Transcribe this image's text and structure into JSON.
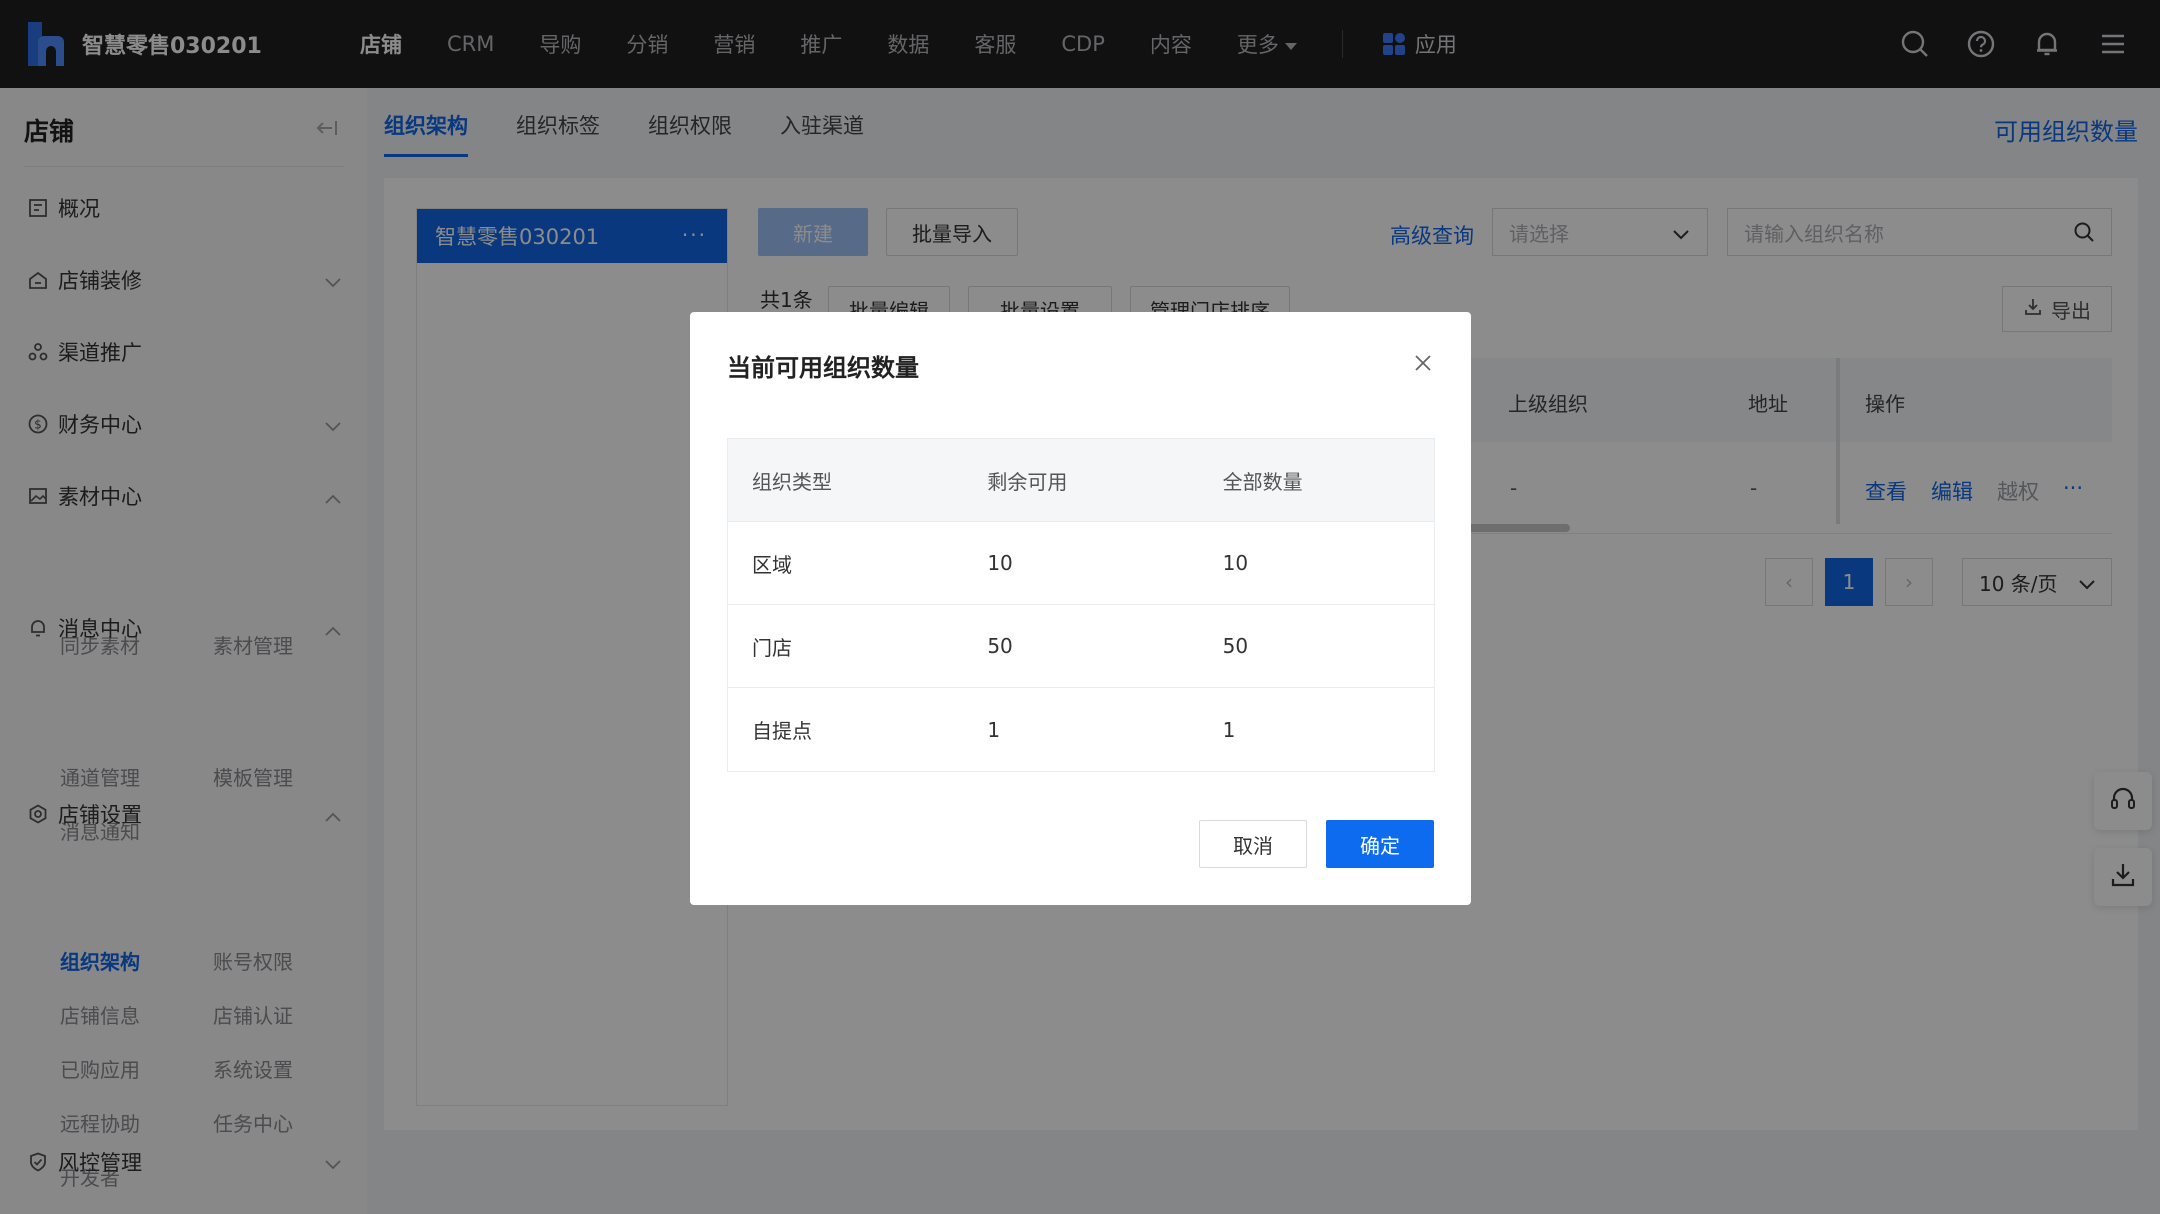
{
  "topbar": {
    "brand": "智慧零售030201",
    "nav": [
      "店铺",
      "CRM",
      "导购",
      "分销",
      "营销",
      "推广",
      "数据",
      "客服",
      "CDP",
      "内容"
    ],
    "more": "更多",
    "app": "应用"
  },
  "sidebar": {
    "title": "店铺",
    "groups": {
      "overview": "概况",
      "decor": "店铺装修",
      "channel": "渠道推广",
      "finance": "财务中心",
      "material": "素材中心",
      "message": "消息中心",
      "settings": "店铺设置",
      "risk": "风控管理"
    },
    "subs": {
      "sync_material": "同步素材",
      "material_mgmt": "素材管理",
      "channel_mgmt": "通道管理",
      "template_mgmt": "模板管理",
      "msg_notice": "消息通知",
      "org": "组织架构",
      "account": "账号权限",
      "store_info": "店铺信息",
      "store_cert": "店铺认证",
      "bought_apps": "已购应用",
      "sys_settings": "系统设置",
      "remote": "远程协助",
      "tasks": "任务中心",
      "developer": "开发者"
    }
  },
  "tabs": [
    "组织架构",
    "组织标签",
    "组织权限",
    "入驻渠道"
  ],
  "tab_link": "可用组织数量",
  "tree": {
    "node": "智慧零售030201",
    "dots": "···"
  },
  "toolbar": {
    "new": "新建",
    "import": "批量导入",
    "advanced": "高级查询",
    "select_placeholder": "请选择",
    "search_placeholder": "请输入组织名称",
    "total": "共1条",
    "batch_edit": "批量编辑",
    "batch_set": "批量设置",
    "sort": "管理门店排序",
    "export": "导出"
  },
  "table": {
    "headers": {
      "parent": "上级组织",
      "address": "地址",
      "ops": "操作"
    },
    "row": {
      "parent": "-",
      "address": "-"
    },
    "ops": {
      "view": "查看",
      "edit": "编辑",
      "override": "越权",
      "more": "···"
    }
  },
  "pager": {
    "prev": "‹",
    "current": "1",
    "next": "›",
    "size": "10 条/页"
  },
  "modal": {
    "title": "当前可用组织数量",
    "headers": [
      "组织类型",
      "剩余可用",
      "全部数量"
    ],
    "rows": [
      [
        "区域",
        "10",
        "10"
      ],
      [
        "门店",
        "50",
        "50"
      ],
      [
        "自提点",
        "1",
        "1"
      ]
    ],
    "cancel": "取消",
    "ok": "确定"
  },
  "colors": {
    "primary": "#1166e8",
    "topbar": "#1f1f22",
    "ok_button": "#0d6bf0"
  }
}
